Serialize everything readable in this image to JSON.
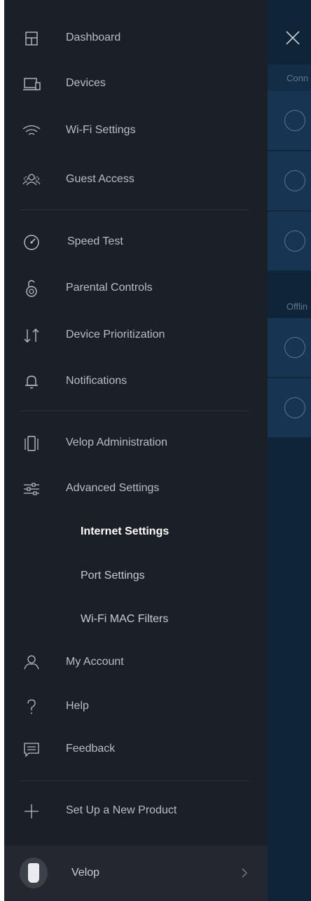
{
  "menu": {
    "items": [
      {
        "label": "Dashboard",
        "icon": "dashboard-icon"
      },
      {
        "label": "Devices",
        "icon": "devices-icon"
      },
      {
        "label": "Wi-Fi Settings",
        "icon": "wifi-icon"
      },
      {
        "label": "Guest Access",
        "icon": "guest-icon"
      },
      {
        "label": "Speed Test",
        "icon": "speedometer-icon"
      },
      {
        "label": "Parental Controls",
        "icon": "lock-icon"
      },
      {
        "label": "Device Prioritization",
        "icon": "priority-arrows-icon"
      },
      {
        "label": "Notifications",
        "icon": "bell-icon"
      },
      {
        "label": "Velop Administration",
        "icon": "node-admin-icon"
      },
      {
        "label": "Advanced Settings",
        "icon": "sliders-icon"
      },
      {
        "label": "My Account",
        "icon": "person-icon"
      },
      {
        "label": "Help",
        "icon": "help-icon"
      },
      {
        "label": "Feedback",
        "icon": "feedback-icon"
      },
      {
        "label": "Set Up a New Product",
        "icon": "plus-icon"
      }
    ],
    "advanced_sub": [
      {
        "label": "Internet Settings",
        "active": true
      },
      {
        "label": "Port Settings",
        "active": false
      },
      {
        "label": "Wi-Fi MAC Filters",
        "active": false
      }
    ],
    "footer": {
      "label": "Velop"
    }
  },
  "right_panel": {
    "section_connected": "Conn",
    "section_offline": "Offlin"
  },
  "colors": {
    "menu_bg": "#1b1f26",
    "footer_bg": "#24282e",
    "panel_bg": "#112840",
    "row_bg": "#173552",
    "text": "#b8bec7",
    "active_text": "#ffffff"
  }
}
